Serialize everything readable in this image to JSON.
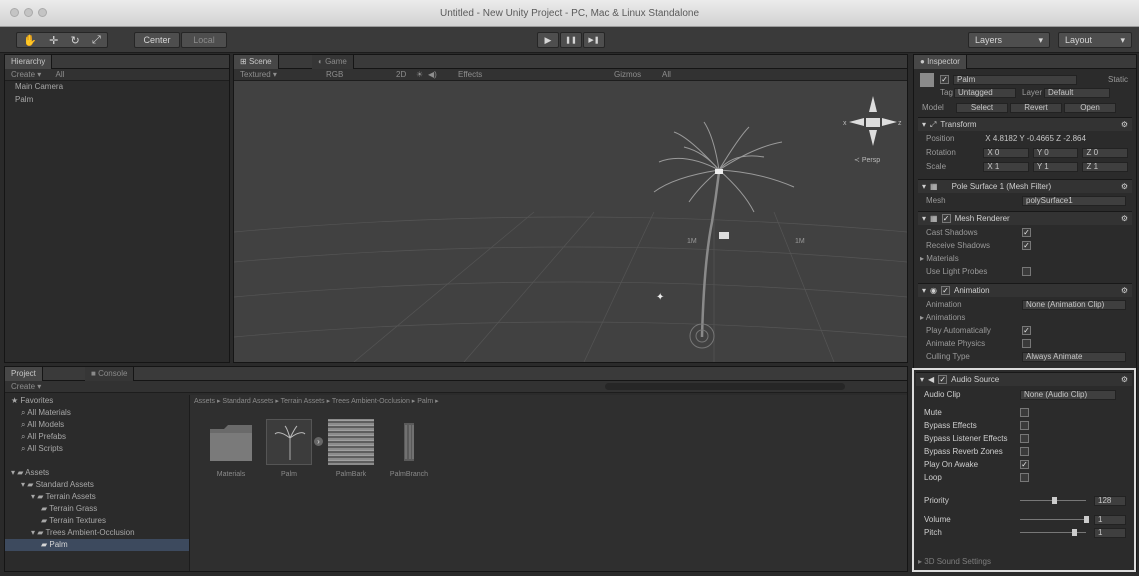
{
  "window": {
    "title": "Untitled - New Unity Project - PC, Mac & Linux Standalone"
  },
  "toolbar": {
    "tools": [
      {
        "name": "hand-icon",
        "glyph": "✋"
      },
      {
        "name": "move-icon",
        "glyph": "✛"
      },
      {
        "name": "rotate-icon",
        "glyph": "↻"
      },
      {
        "name": "scale-icon",
        "glyph": "⤢"
      }
    ],
    "pivot_label": "Center",
    "space_label": "Local",
    "play_glyph": "▶",
    "pause_glyph": "❚❚",
    "step_glyph": "▶❚",
    "layers_label": "Layers",
    "layout_label": "Layout"
  },
  "hierarchy": {
    "tab": "Hierarchy",
    "create_label": "Create",
    "search_label": "All",
    "items": [
      "Main Camera",
      "Palm"
    ]
  },
  "scene": {
    "tabs": [
      "Scene",
      "Game"
    ],
    "shading": "Textured",
    "mode": "RGB",
    "view2d": "2D",
    "effects": "Effects",
    "gizmos": "Gizmos",
    "search_label": "All",
    "persp_label": "Persp",
    "axis_left": "x",
    "axis_right": "z",
    "grid_label_left": "1M",
    "grid_label_right": "1M"
  },
  "project": {
    "tabs": [
      "Project",
      "Console"
    ],
    "create_label": "Create",
    "tree": [
      {
        "label": "Favorites",
        "level": 0,
        "icon": "star-icon"
      },
      {
        "label": "All Materials",
        "level": 1,
        "icon": "search-icon"
      },
      {
        "label": "All Models",
        "level": 1,
        "icon": "search-icon"
      },
      {
        "label": "All Prefabs",
        "level": 1,
        "icon": "search-icon"
      },
      {
        "label": "All Scripts",
        "level": 1,
        "icon": "search-icon"
      },
      {
        "label": "",
        "level": 0,
        "icon": ""
      },
      {
        "label": "Assets",
        "level": 0,
        "icon": "folder-icon"
      },
      {
        "label": "Standard Assets",
        "level": 1,
        "icon": "folder-icon"
      },
      {
        "label": "Terrain Assets",
        "level": 2,
        "icon": "folder-icon"
      },
      {
        "label": "Terrain Grass",
        "level": 3,
        "icon": "folder-icon"
      },
      {
        "label": "Terrain Textures",
        "level": 3,
        "icon": "folder-icon"
      },
      {
        "label": "Trees Ambient-Occlusion",
        "level": 2,
        "icon": "folder-icon"
      },
      {
        "label": "Palm",
        "level": 3,
        "icon": "folder-icon",
        "selected": true
      }
    ],
    "breadcrumb": "Assets ▸ Standard Assets ▸ Terrain Assets ▸ Trees Ambient-Occlusion ▸ Palm ▸",
    "assets": [
      "Materials",
      "Palm",
      "PalmBark",
      "PalmBranch"
    ]
  },
  "inspector": {
    "tab": "Inspector",
    "object_name": "Palm",
    "static_label": "Static",
    "tag_label": "Tag",
    "tag_value": "Untagged",
    "layer_label": "Layer",
    "layer_value": "Default",
    "model_label": "Model",
    "model_buttons": [
      "Select",
      "Revert",
      "Open"
    ],
    "transform": {
      "title": "Transform",
      "position_label": "Position",
      "position": "X 4.8182  Y -0.4665  Z -2.864",
      "rotation_label": "Rotation",
      "rotation": {
        "x": "X 0",
        "y": "Y 0",
        "z": "Z 0"
      },
      "scale_label": "Scale",
      "scale": {
        "x": "X 1",
        "y": "Y 1",
        "z": "Z 1"
      }
    },
    "mesh_filter": {
      "title": "Pole Surface 1 (Mesh Filter)",
      "mesh_label": "Mesh",
      "mesh_value": "polySurface1"
    },
    "mesh_renderer": {
      "title": "Mesh Renderer",
      "cast_label": "Cast Shadows",
      "receive_label": "Receive Shadows",
      "materials_label": "Materials",
      "probes_label": "Use Light Probes"
    },
    "animation": {
      "title": "Animation",
      "animation_label": "Animation",
      "animation_value": "None (Animation Clip)",
      "animations_label": "Animations",
      "play_auto_label": "Play Automatically",
      "physics_label": "Animate Physics",
      "culling_label": "Culling Type",
      "culling_value": "Always Animate"
    },
    "audio_source": {
      "title": "Audio Source",
      "clip_label": "Audio Clip",
      "clip_value": "None (Audio Clip)",
      "rows": [
        {
          "label": "Mute",
          "checked": false
        },
        {
          "label": "Bypass Effects",
          "checked": false
        },
        {
          "label": "Bypass Listener Effects",
          "checked": false
        },
        {
          "label": "Bypass Reverb Zones",
          "checked": false
        },
        {
          "label": "Play On Awake",
          "checked": true
        },
        {
          "label": "Loop",
          "checked": false
        }
      ],
      "priority_label": "Priority",
      "priority_value": "128",
      "volume_label": "Volume",
      "volume_value": "1",
      "pitch_label": "Pitch",
      "pitch_value": "1",
      "settings_label": "3D Sound Settings"
    }
  },
  "colors": {
    "highlight": "#e0e0e0",
    "selection": "#3d4a5e",
    "scene_bg": "#414141"
  }
}
